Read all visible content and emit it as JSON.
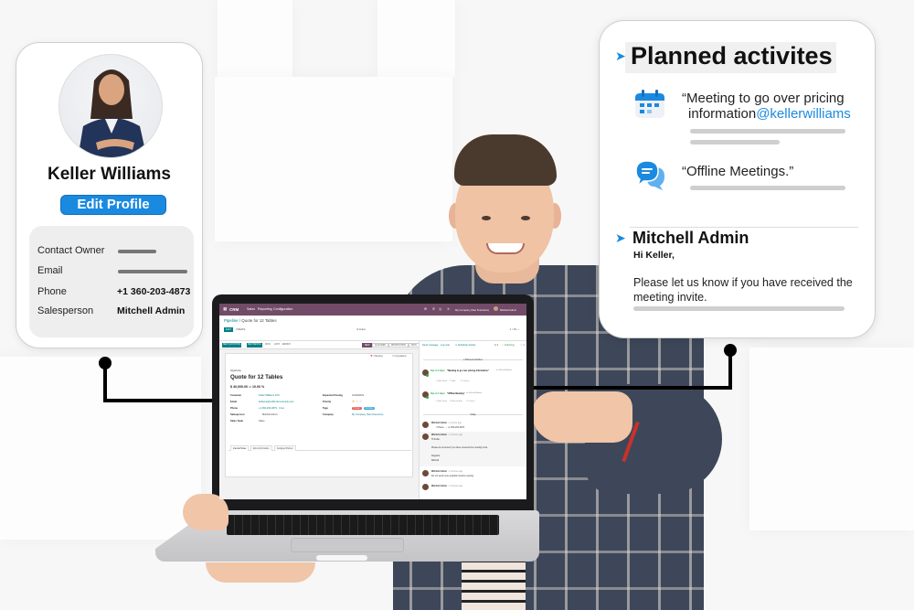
{
  "profile_card": {
    "name": "Keller Williams",
    "edit_button": "Edit Profile",
    "fields": [
      {
        "label": "Contact Owner",
        "value": null
      },
      {
        "label": "Email",
        "value": null
      },
      {
        "label": "Phone",
        "value": "+1 360-203-4873"
      },
      {
        "label": "Salesperson",
        "value": "Mitchell Admin"
      }
    ],
    "accent_color": "#1a8ae0"
  },
  "activities_card": {
    "title": "Planned activites",
    "items": [
      {
        "icon": "calendar-icon",
        "text": "“Meeting to go over pricing",
        "text_line2": "information",
        "mention": "@kellerwilliams"
      },
      {
        "icon": "chat-bubble-icon",
        "text": "“Offline Meetings.”"
      }
    ],
    "message": {
      "author": "Mitchell Admin",
      "greeting": "Hi Keller,",
      "body": "Please let us know if you have received the meeting invite."
    }
  },
  "screen": {
    "navbar": {
      "brand": "CRM",
      "menu": [
        "Sales",
        "Reporting",
        "Configuration"
      ],
      "company": "My Company (San Francisco)",
      "user": "Mitchell Admin",
      "color": "#714b67"
    },
    "breadcrumb": {
      "parent": "Pipeline",
      "current": "Quote for 12 Tables"
    },
    "buttons": {
      "edit": "EDIT",
      "create": "CREATE",
      "action": "⚙ Action"
    },
    "pager": "1 / 18",
    "status_buttons": [
      "NEW QUOTATION",
      "NEW RENTAL"
    ],
    "status_links": [
      "WON",
      "LOST",
      "ENRICH"
    ],
    "stages": [
      "NEW",
      "QUALIFIED",
      "PROPOSITION",
      "WON"
    ],
    "active_stage": "NEW",
    "smart_buttons": [
      {
        "count": "1",
        "label": "Meeting"
      },
      {
        "count": "0",
        "label": "Quotations"
      }
    ],
    "form": {
      "type_label": "Opportunity",
      "title": "Quote for 12 Tables",
      "revenue": "$ 40,000.00",
      "probability_prefix": "at",
      "probability": "10.00 %",
      "left_fields": [
        {
          "label": "Customer",
          "value": "Keller Williams NYC"
        },
        {
          "label": "Email",
          "value": "kellwms@notfhmail.example.com"
        },
        {
          "label": "Phone",
          "value": "+1 360-203-4873 · Cnet"
        },
        {
          "label": "Salesperson",
          "value": "Mitchell Admin"
        },
        {
          "label": "Sales Team",
          "value": "Sales"
        }
      ],
      "right_fields": [
        {
          "label": "Expected Closing",
          "value": "01/19/2023"
        },
        {
          "label": "Priority",
          "value": ""
        },
        {
          "label": "Tags",
          "value": ""
        },
        {
          "label": "Company",
          "value": "My Company (San Francisco)"
        }
      ],
      "priority_stars": 1,
      "priority_max": 3,
      "tags": [
        {
          "label": "Product",
          "color": "#e0524a"
        },
        {
          "label": "Furniture",
          "color": "#3ba4d8"
        }
      ],
      "tabs": [
        "Internal Notes",
        "Extra Information",
        "Assigned Partner"
      ]
    },
    "chatter": {
      "top_links": [
        "Send message",
        "Log note",
        "⊙ Schedule activity"
      ],
      "attachments": "⎘ 0",
      "follow": "✓ Following",
      "followers": "☺ 1",
      "planned_label": "▾ Planned activities",
      "today_label": "Today",
      "activities": [
        {
          "due": "Due in 3 days:",
          "title": "“Meeting to go over pricing information”",
          "assignee": "for Mitchell Admin",
          "actions": [
            "✓ Mark Done",
            "✎ Edit",
            "✕ Cancel"
          ]
        },
        {
          "due": "Due in 2 days:",
          "title": "“Offline Meeting”",
          "assignee": "for Mitchell Admin",
          "actions": [
            "✓ Mark Done",
            "↻ Reschedule",
            "✕ Cancel"
          ]
        }
      ],
      "messages": [
        {
          "author": "Mitchell Admin",
          "time": "- a minute ago",
          "body": "• Phone: → +1 360-203-4873"
        },
        {
          "author": "Mitchell Admin",
          "time": "- 2 minutes ago",
          "body": "Hi Keller,",
          "body2": "Please let us know if you have received the meeting invite.",
          "body3": "Regards,",
          "body4": "Mitchell"
        },
        {
          "author": "Mitchell Admin",
          "time": "- 2 minutes ago",
          "body": "Do not send more quotation before meeting"
        },
        {
          "author": "Mitchell Admin",
          "time": "- 2 minutes ago",
          "body": ""
        }
      ]
    }
  }
}
